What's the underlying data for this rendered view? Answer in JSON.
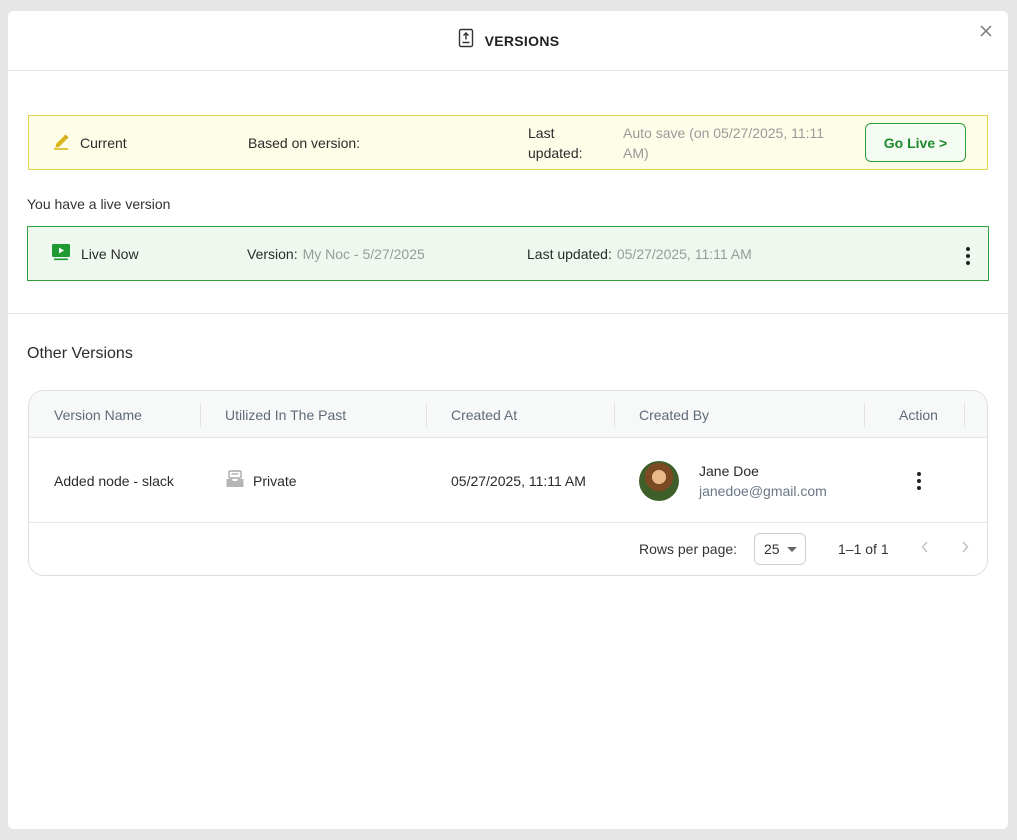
{
  "header": {
    "title": "VERSIONS"
  },
  "current": {
    "label": "Current",
    "based_on_label": "Based on version:",
    "based_on_value": "",
    "last_updated_label_line1": "Last",
    "last_updated_label_line2": "updated:",
    "last_updated_value_line1": "Auto save (on 05/27/2025, 11:11",
    "last_updated_value_line2": "AM)",
    "go_live_label": "Go Live >"
  },
  "live_notice": "You have a live version",
  "live": {
    "label": "Live Now",
    "version_label": "Version:",
    "version_value": "My Noc - 5/27/2025",
    "last_updated_label": "Last updated:",
    "last_updated_value": "05/27/2025, 11:11 AM"
  },
  "other_versions": {
    "title": "Other Versions",
    "columns": [
      "Version Name",
      "Utilized In The Past",
      "Created At",
      "Created By",
      "Action"
    ],
    "rows": [
      {
        "version_name": "Added node - slack",
        "utilized": "Private",
        "created_at": "05/27/2025, 11:11 AM",
        "created_by_name": "Jane Doe",
        "created_by_email": "janedoe@gmail.com"
      }
    ],
    "footer": {
      "rows_per_page_label": "Rows per page:",
      "rows_per_page_value": "25",
      "page_range": "1–1 of 1"
    }
  },
  "colors": {
    "current_bg": "#fefde8",
    "current_border": "#e3d44a",
    "live_bg": "#eef8ee",
    "live_border": "#2e9e3e",
    "accent_green": "#1f8a2f"
  },
  "icons": {
    "title": "upload-document-icon",
    "current": "pencil-icon",
    "live": "play-screen-icon",
    "utilized": "inbox-tray-icon",
    "close": "close-icon",
    "action": "kebab-menu-icon"
  }
}
